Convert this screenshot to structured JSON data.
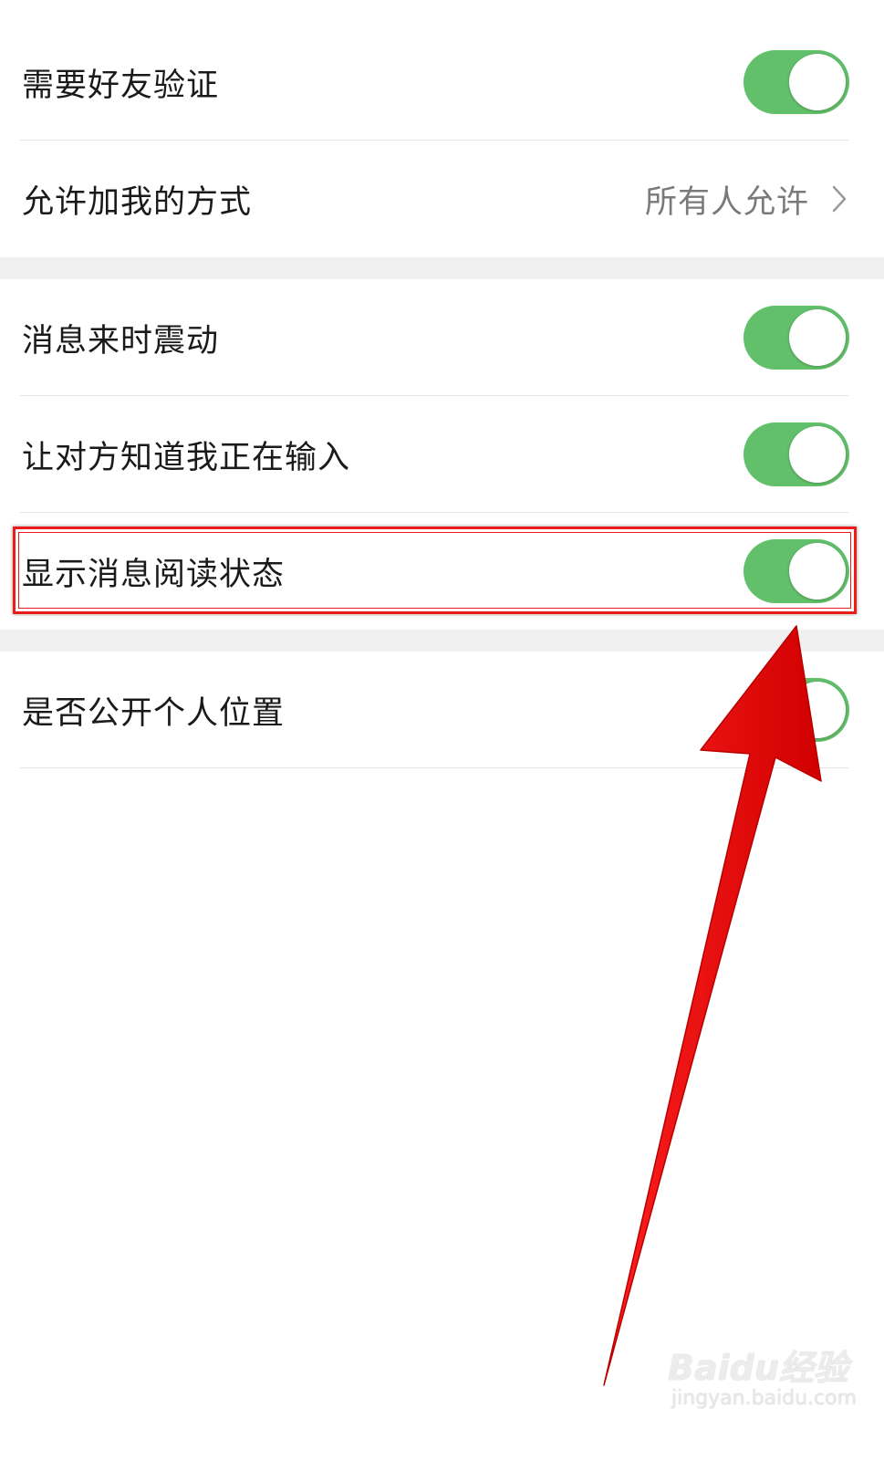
{
  "settings": {
    "friend_verification": {
      "label": "需要好友验证",
      "on": true
    },
    "add_method": {
      "label": "允许加我的方式",
      "value": "所有人允许"
    },
    "vibrate": {
      "label": "消息来时震动",
      "on": true
    },
    "typing_status": {
      "label": "让对方知道我正在输入",
      "on": true
    },
    "read_status": {
      "label": "显示消息阅读状态",
      "on": true
    },
    "public_location": {
      "label": "是否公开个人位置",
      "on": true
    }
  },
  "watermark": {
    "brand": "Baidu经验",
    "url": "jingyan.baidu.com"
  },
  "colors": {
    "toggle_on": "#62bf6a",
    "annotation": "#ee1b1b"
  }
}
